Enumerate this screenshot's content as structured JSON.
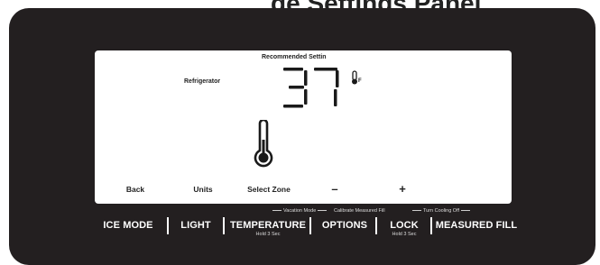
{
  "header": {
    "partial_title": "ge Settings Panel"
  },
  "display": {
    "recommended_label": "Recommended Settin",
    "zone_label": "Refrigerator",
    "temperature": "37",
    "unit": "F",
    "softkeys": [
      "Back",
      "Units",
      "Select Zone",
      "–",
      "+"
    ]
  },
  "hints": {
    "vacation": "Vacation Mode",
    "calibrate": "Calibrate Measured Fill",
    "turn_cooling": "Turn Cooling Off"
  },
  "buttons": [
    {
      "label": "ICE MODE"
    },
    {
      "label": "LIGHT"
    },
    {
      "label": "TEMPERATURE",
      "sub": "Hold 3 Sec"
    },
    {
      "label": "OPTIONS"
    },
    {
      "label": "LOCK",
      "sub": "Hold 3 Sec"
    },
    {
      "label": "MEASURED FILL"
    }
  ],
  "colors": {
    "panel": "#231f20",
    "display": "#ffffff",
    "segment": "#1a1a1a"
  }
}
